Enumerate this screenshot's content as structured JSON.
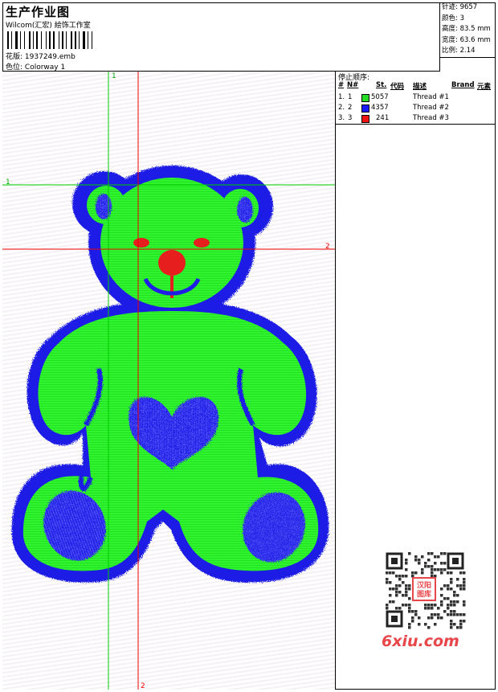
{
  "header": {
    "title": "生产作业图",
    "company": "Wilcom(汇宏) 絵饰工作室",
    "design_label": "花版:",
    "design_value": "1937249.emb",
    "colorway_label": "色位:",
    "colorway_value": "Colorway 1"
  },
  "stats": {
    "stitches_label": "针迹:",
    "stitches_value": "9657",
    "colors_label": "颜色:",
    "colors_value": "3",
    "height_label": "高度:",
    "height_value": "83.5 mm",
    "width_label": "宽度:",
    "width_value": "63.6 mm",
    "scale_label": "比例:",
    "scale_value": "2.14"
  },
  "stop_sequence": {
    "title": "停止顺序:",
    "columns": [
      "#",
      "N#",
      "St.",
      "代码",
      "描述",
      "Brand",
      "元素"
    ],
    "rows": [
      {
        "index": "1.",
        "needle": "1",
        "code": "5057",
        "description": "Thread #1",
        "color": "#22dd22"
      },
      {
        "index": "2.",
        "needle": "2",
        "code": "4357",
        "description": "Thread #2",
        "color": "#1a1aff"
      },
      {
        "index": "3.",
        "needle": "3",
        "code": "241",
        "description": "Thread #3",
        "color": "#ee1111"
      }
    ]
  },
  "guides": {
    "green_h_label": "1",
    "green_v_label": "1",
    "red_h_label": "2",
    "red_v_label": "2",
    "green_color": "#00cc00",
    "red_color": "#ee0000"
  },
  "colors": {
    "fill_green": "#2ef52e",
    "outline_blue": "#1e1ee6",
    "accent_red": "#e61e1e"
  },
  "watermark": {
    "qr_center_text": "汉阳\n图库",
    "site_text": "6xiu.com"
  }
}
